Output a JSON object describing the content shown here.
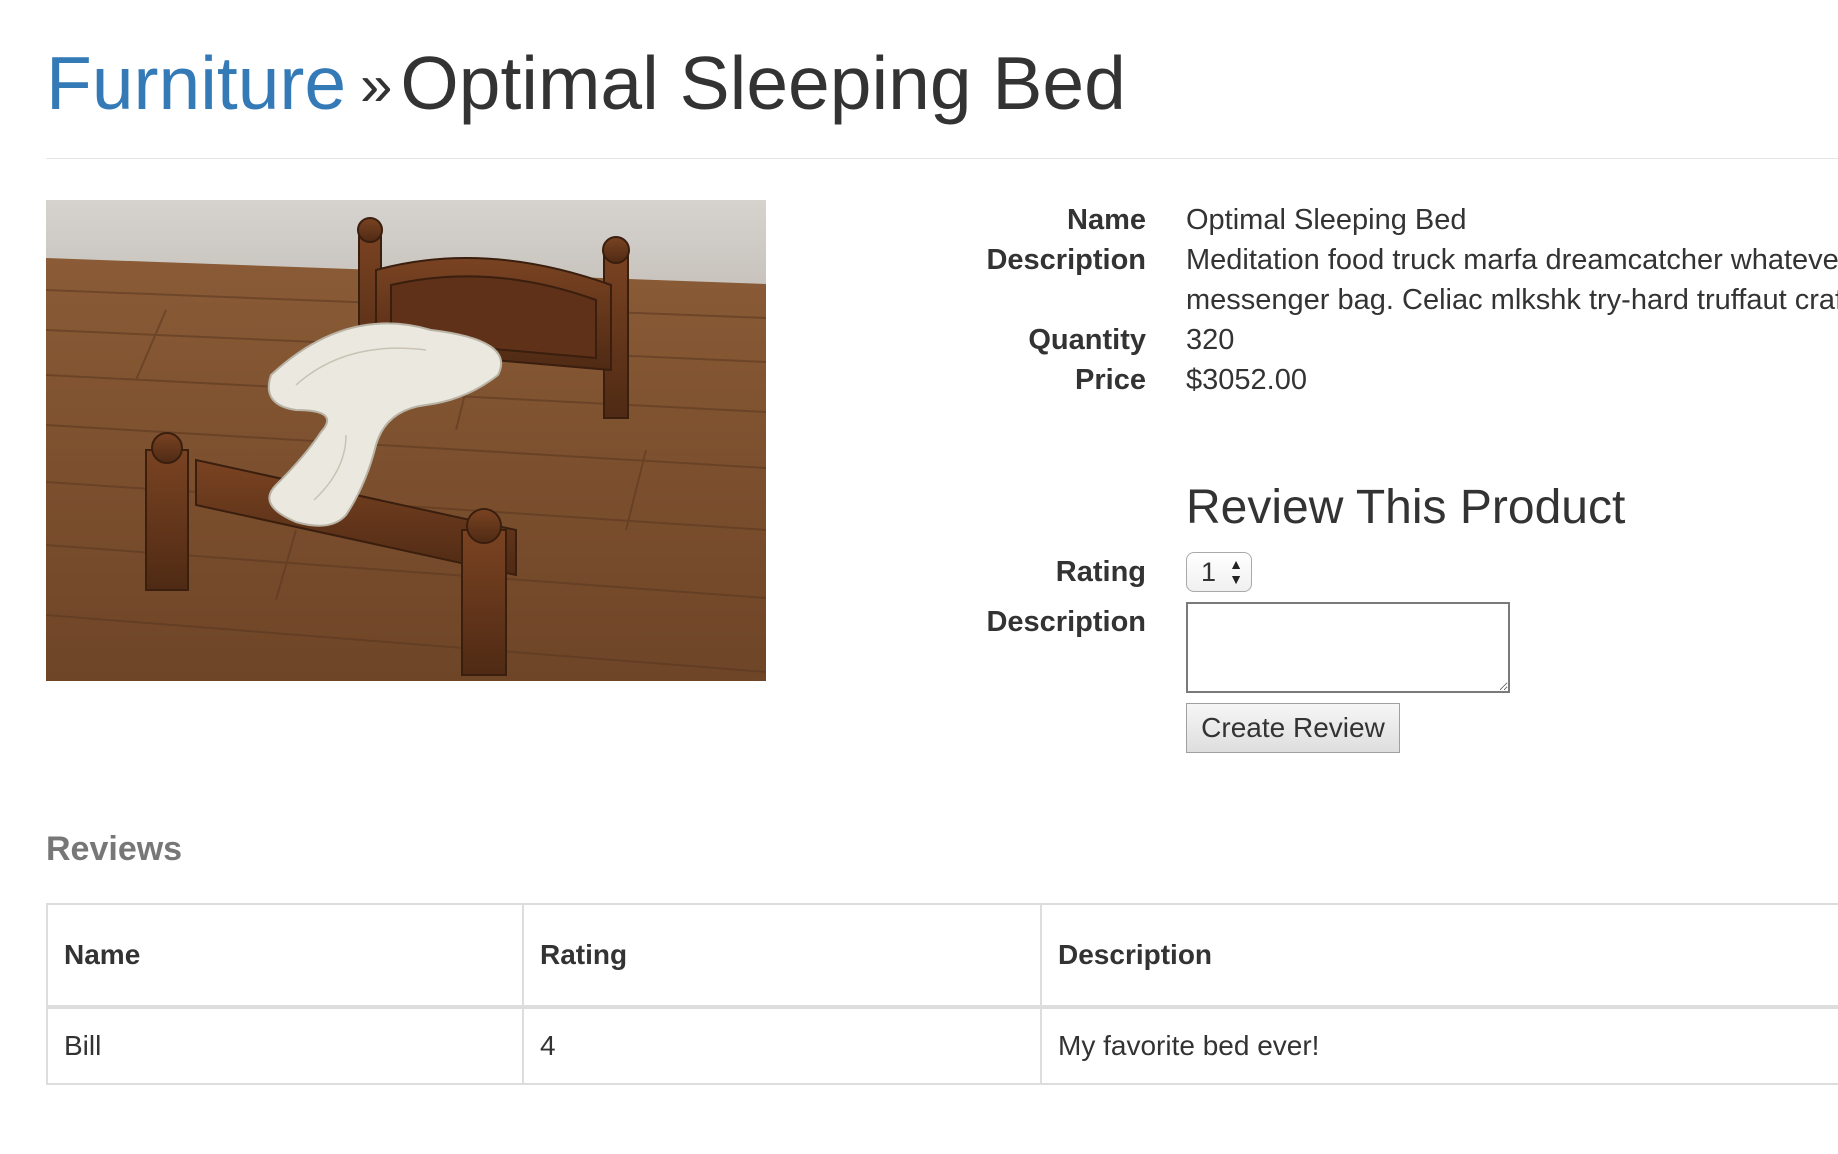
{
  "breadcrumb": {
    "category": "Furniture",
    "separator": "»",
    "product": "Optimal Sleeping Bed"
  },
  "details": {
    "name_label": "Name",
    "name_value": "Optimal Sleeping Bed",
    "description_label": "Description",
    "description_value": "Meditation food truck marfa dreamcatcher whatever messenger bag. Celiac mlkshk try-hard truffaut craft",
    "quantity_label": "Quantity",
    "quantity_value": "320",
    "price_label": "Price",
    "price_value": "$3052.00"
  },
  "review_form": {
    "heading": "Review This Product",
    "rating_label": "Rating",
    "rating_value": "1",
    "description_label": "Description",
    "description_value": "",
    "submit_label": "Create Review"
  },
  "reviews": {
    "heading": "Reviews",
    "columns": [
      "Name",
      "Rating",
      "Description"
    ],
    "rows": [
      {
        "name": "Bill",
        "rating": "4",
        "description": "My favorite bed ever!"
      }
    ]
  },
  "colors": {
    "link": "#337ab7",
    "text": "#333333",
    "muted_heading": "#777777",
    "table_border": "#dddddd"
  }
}
